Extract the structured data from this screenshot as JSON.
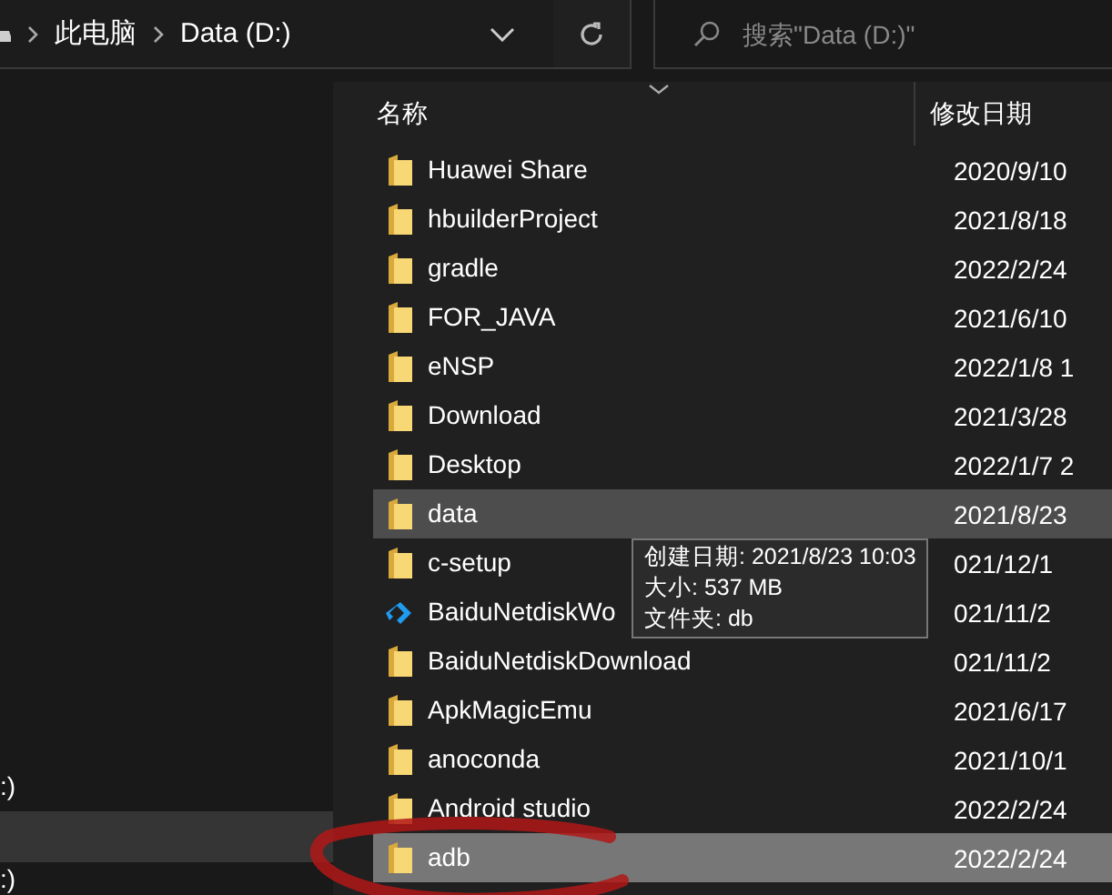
{
  "address_bar": {
    "crumbs": [
      "此电脑",
      "Data (D:)"
    ]
  },
  "search": {
    "placeholder": "搜索\"Data (D:)\""
  },
  "nav_pane": {
    "items": [
      {
        "label": ":)",
        "selected": false
      },
      {
        "selected": true
      },
      {
        "label": ":)",
        "selected": false
      }
    ]
  },
  "columns": [
    "名称",
    "修改日期"
  ],
  "files": [
    {
      "kind": "folder",
      "name": "Huawei Share",
      "date": "2020/9/10",
      "hovered": false,
      "selected": false,
      "circled": false
    },
    {
      "kind": "folder",
      "name": "hbuilderProject",
      "date": "2021/8/18",
      "hovered": false,
      "selected": false,
      "circled": false
    },
    {
      "kind": "folder",
      "name": "gradle",
      "date": "2022/2/24",
      "hovered": false,
      "selected": false,
      "circled": false
    },
    {
      "kind": "folder",
      "name": "FOR_JAVA",
      "date": "2021/6/10",
      "hovered": false,
      "selected": false,
      "circled": false
    },
    {
      "kind": "folder",
      "name": "eNSP",
      "date": "2022/1/8 1",
      "hovered": false,
      "selected": false,
      "circled": false
    },
    {
      "kind": "folder",
      "name": "Download",
      "date": "2021/3/28",
      "hovered": false,
      "selected": false,
      "circled": false
    },
    {
      "kind": "folder",
      "name": "Desktop",
      "date": "2022/1/7 2",
      "hovered": false,
      "selected": false,
      "circled": false
    },
    {
      "kind": "folder",
      "name": "data",
      "date": "2021/8/23",
      "hovered": true,
      "selected": false,
      "circled": false
    },
    {
      "kind": "folder",
      "name": "c-setup",
      "date": "021/12/1",
      "hovered": false,
      "selected": false,
      "circled": false
    },
    {
      "kind": "app",
      "name": "BaiduNetdiskWo",
      "date": "021/11/2",
      "hovered": false,
      "selected": false,
      "circled": false
    },
    {
      "kind": "folder",
      "name": "BaiduNetdiskDownload",
      "date": "021/11/2",
      "hovered": false,
      "selected": false,
      "circled": false
    },
    {
      "kind": "folder",
      "name": "ApkMagicEmu",
      "date": "2021/6/17",
      "hovered": false,
      "selected": false,
      "circled": false
    },
    {
      "kind": "folder",
      "name": "anoconda",
      "date": "2021/10/1",
      "hovered": false,
      "selected": false,
      "circled": false
    },
    {
      "kind": "folder",
      "name": "Android studio",
      "date": "2022/2/24",
      "hovered": false,
      "selected": false,
      "circled": false
    },
    {
      "kind": "folder",
      "name": "adb",
      "date": "2022/2/24",
      "hovered": false,
      "selected": true,
      "circled": true
    }
  ],
  "tooltip": {
    "lines": [
      "创建日期: 2021/8/23 10:03",
      "大小: 537 MB",
      "文件夹: db"
    ]
  }
}
